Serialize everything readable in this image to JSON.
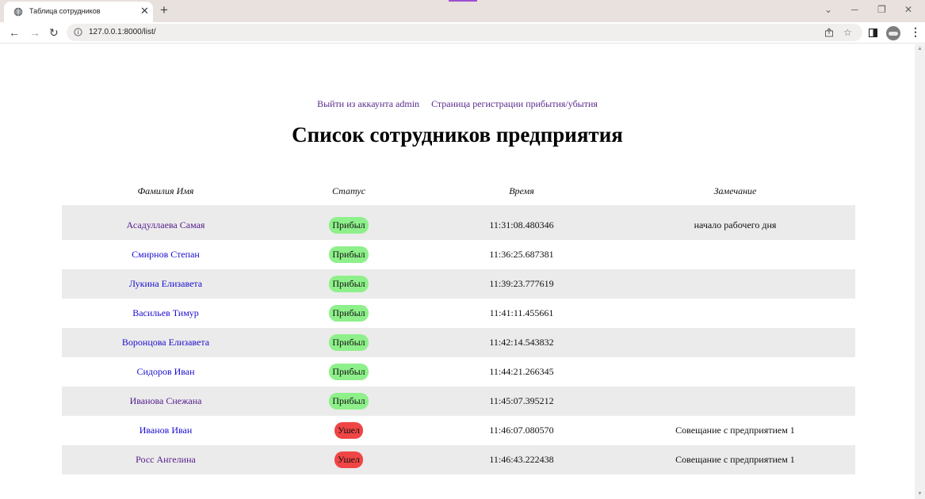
{
  "browser": {
    "tab_title": "Таблица сотрудников",
    "url": "127.0.0.1:8000/list/"
  },
  "page": {
    "links": [
      {
        "label": "Выйти из аккаунта admin"
      },
      {
        "label": "Страница регистрации прибытия/убытия"
      }
    ],
    "title": "Список сотрудников предприятия",
    "columns": [
      "Фамилия Имя",
      "Статус",
      "Время",
      "Замечание"
    ],
    "rows": [
      {
        "name": "Асадуллаева Самая",
        "status": "Прибыл",
        "time": "11:31:08.480346",
        "note": "начало рабочего дня",
        "visited": true
      },
      {
        "name": "Смирнов Степан",
        "status": "Прибыл",
        "time": "11:36:25.687381",
        "note": "",
        "visited": false
      },
      {
        "name": "Лукина Елизавета",
        "status": "Прибыл",
        "time": "11:39:23.777619",
        "note": "",
        "visited": false
      },
      {
        "name": "Васильев Тимур",
        "status": "Прибыл",
        "time": "11:41:11.455661",
        "note": "",
        "visited": false
      },
      {
        "name": "Воронцова Елизавета",
        "status": "Прибыл",
        "time": "11:42:14.543832",
        "note": "",
        "visited": false
      },
      {
        "name": "Сидоров Иван",
        "status": "Прибыл",
        "time": "11:44:21.266345",
        "note": "",
        "visited": false
      },
      {
        "name": "Иванова Снежана",
        "status": "Прибыл",
        "time": "11:45:07.395212",
        "note": "",
        "visited": true
      },
      {
        "name": "Иванов Иван",
        "status": "Ушел",
        "time": "11:46:07.080570",
        "note": "Совещание с предприятием 1",
        "visited": false
      },
      {
        "name": "Росс Ангелина",
        "status": "Ушел",
        "time": "11:46:43.222438",
        "note": "Совещание с предприятием 1",
        "visited": true
      }
    ]
  },
  "colors": {
    "arrived": "#8ef08a",
    "left": "#f04545",
    "link": "#1a0dce",
    "visited_link": "#551a8b",
    "row_stripe": "#ebebeb"
  },
  "icons": {
    "tab_favicon": "globe-icon",
    "info": "info-icon",
    "share": "share-icon",
    "bookmark": "star-icon",
    "side_panel": "side-panel-icon"
  }
}
